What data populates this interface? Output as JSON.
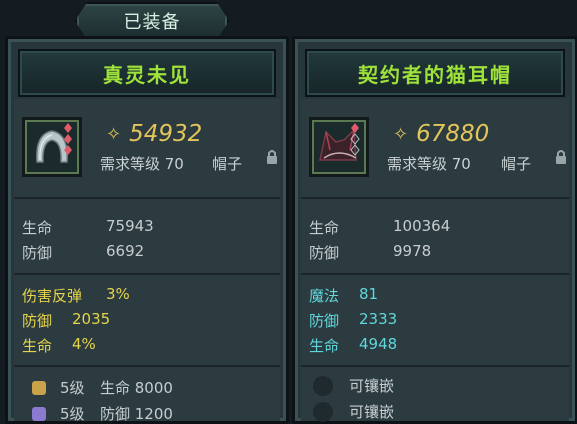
{
  "header": {
    "equipped_label": "已装备"
  },
  "left": {
    "name": "真灵未见",
    "price": "54932",
    "requirement": "需求等级 70",
    "slot": "帽子",
    "base_stats": [
      {
        "label": "生命",
        "value": "75943"
      },
      {
        "label": "防御",
        "value": "6692"
      }
    ],
    "bonus_stats": [
      {
        "label": "伤害反弹",
        "value": "3%"
      },
      {
        "label": "防御",
        "value": "2035"
      },
      {
        "label": "生命",
        "value": "4%"
      }
    ],
    "sockets": [
      {
        "level": "5级",
        "text": "生命 8000",
        "gem_color": "#c9a24a"
      },
      {
        "level": "5级",
        "text": "防御 1200",
        "gem_color": "#8a7bd0"
      }
    ]
  },
  "right": {
    "name": "契约者的猫耳帽",
    "price": "67880",
    "requirement": "需求等级 70",
    "slot": "帽子",
    "base_stats": [
      {
        "label": "生命",
        "value": "100364"
      },
      {
        "label": "防御",
        "value": "9978"
      }
    ],
    "bonus_stats": [
      {
        "label": "魔法",
        "value": "81"
      },
      {
        "label": "防御",
        "value": "2333"
      },
      {
        "label": "生命",
        "value": "4948"
      }
    ],
    "sockets": [
      {
        "text": "可镶嵌"
      },
      {
        "text": "可镶嵌"
      }
    ]
  },
  "colors": {
    "name_green": "#9fe23a",
    "price_gold": "#e3c55b",
    "bonus_yellow": "#e6d44a",
    "bonus_cyan": "#5fd7dc"
  }
}
